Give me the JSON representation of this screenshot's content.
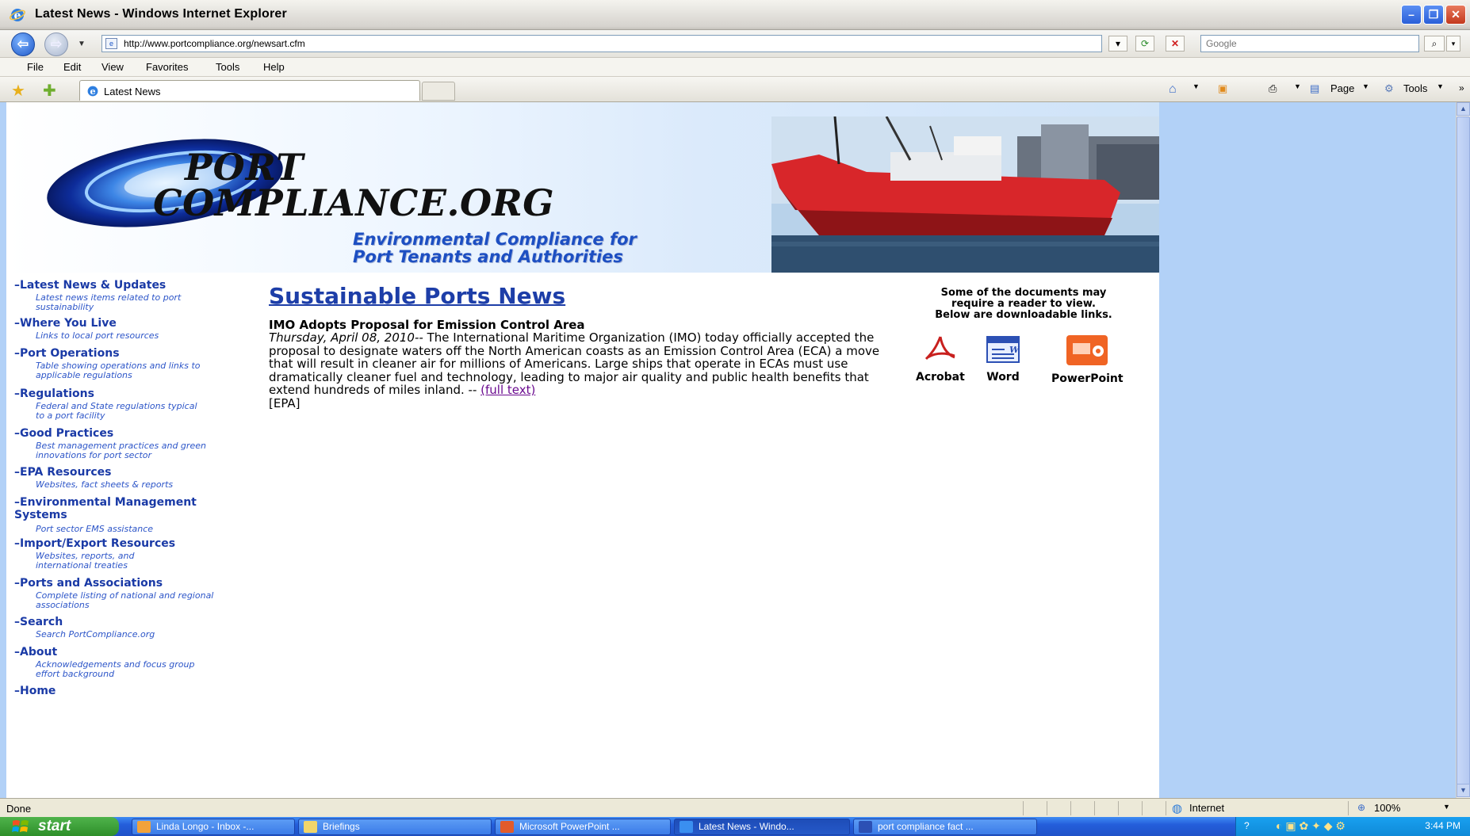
{
  "window": {
    "title": "Latest News - Windows Internet Explorer"
  },
  "addressbar": {
    "url": "http://www.portcompliance.org/newsart.cfm",
    "search_placeholder": "Google"
  },
  "menu": [
    "File",
    "Edit",
    "View",
    "Favorites",
    "Tools",
    "Help"
  ],
  "tab": {
    "label": "Latest News"
  },
  "commandbar": {
    "page_label": "Page",
    "tools_label": "Tools"
  },
  "site": {
    "logo_line1": "PORT",
    "logo_line2": "COMPLIANCE.ORG",
    "tagline_line1": "Environmental Compliance for",
    "tagline_line2": "Port Tenants and Authorities"
  },
  "nav": [
    {
      "title": "Latest News & Updates",
      "desc": "Latest news items related to port sustainability"
    },
    {
      "title": "Where You Live",
      "desc": "Links to local port resources"
    },
    {
      "title": "Port Operations",
      "desc": "Table showing operations and links to applicable regulations"
    },
    {
      "title": "Regulations",
      "desc": "Federal and State regulations typical to a port facility"
    },
    {
      "title": "Good Practices",
      "desc": "Best management practices and green innovations for port sector"
    },
    {
      "title": "EPA Resources",
      "desc": "Websites, fact sheets & reports"
    },
    {
      "title": "Environmental Management Systems",
      "desc": "Port sector EMS assistance"
    },
    {
      "title": "Import/Export Resources",
      "desc": "Websites, reports, and international treaties"
    },
    {
      "title": "Ports and Associations",
      "desc": "Complete listing of national and regional associations"
    },
    {
      "title": "Search",
      "desc": "Search PortCompliance.org"
    },
    {
      "title": "About",
      "desc": "Acknowledgements and focus group effort background"
    },
    {
      "title": "Home",
      "desc": ""
    }
  ],
  "main": {
    "heading": "Sustainable Ports News",
    "article": {
      "headline": "IMO Adopts Proposal for Emission Control Area",
      "date": "Thursday, April 08, 2010--",
      "text": " The International Maritime Organization (IMO) today officially accepted the proposal to designate waters off the North American coasts as an Emission Control Area (ECA) a move that will result in cleaner air for millions of Americans. Large ships that operate in ECAs must use dramatically cleaner fuel and technology, leading to major air quality and public health benefits that extend hundreds of miles inland. -- ",
      "link": "(full text)",
      "source": "[EPA]"
    }
  },
  "readers": {
    "note_line1": "Some of the documents may",
    "note_line2": "require a reader to view.",
    "note_line3": "Below are downloadable links.",
    "acrobat": "Acrobat",
    "word": "Word",
    "powerpoint": "PowerPoint"
  },
  "statusbar": {
    "status": "Done",
    "zone": "Internet",
    "zoom": "100%"
  },
  "taskbar": {
    "start": "start",
    "tasks": [
      "Linda Longo - Inbox -...",
      "Briefings",
      "Microsoft PowerPoint ...",
      "Latest News - Windo...",
      "port compliance fact ..."
    ],
    "clock": "3:44 PM"
  }
}
